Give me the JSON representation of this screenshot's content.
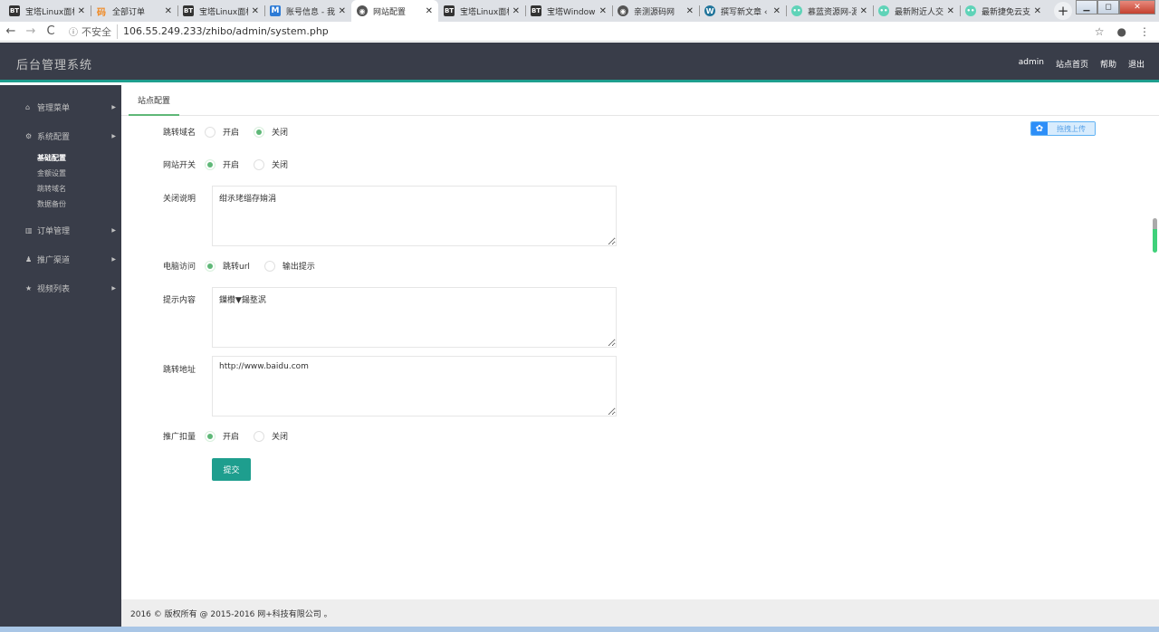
{
  "browser": {
    "tabs": [
      {
        "icon": "bt-icon",
        "glyph": "BT",
        "cls": "bt",
        "title": "宝塔Linux面板",
        "active": false
      },
      {
        "icon": "order-icon",
        "glyph": "码",
        "cls": "order",
        "title": "全部订单",
        "active": false
      },
      {
        "icon": "bt-icon",
        "glyph": "BT",
        "cls": "bt",
        "title": "宝塔Linux面板",
        "active": false
      },
      {
        "icon": "m-icon",
        "glyph": "M",
        "cls": "m",
        "title": "账号信息 - 我的",
        "active": false
      },
      {
        "icon": "globe-icon",
        "glyph": "◉",
        "cls": "globe",
        "title": "网站配置",
        "active": true
      },
      {
        "icon": "bt-icon",
        "glyph": "BT",
        "cls": "bt",
        "title": "宝塔Linux面板",
        "active": false
      },
      {
        "icon": "bt-icon",
        "glyph": "BT",
        "cls": "bt",
        "title": "宝塔Windows",
        "active": false
      },
      {
        "icon": "globe-icon",
        "glyph": "◉",
        "cls": "globe",
        "title": "亲测源码网",
        "active": false
      },
      {
        "icon": "wordpress-icon",
        "glyph": "W",
        "cls": "wp",
        "title": "撰写新文章 ‹",
        "active": false
      },
      {
        "icon": "face-icon",
        "glyph": "••",
        "cls": "face",
        "title": "慕蓝资源网-源",
        "active": false
      },
      {
        "icon": "face-icon",
        "glyph": "••",
        "cls": "face",
        "title": "最新附近人交友",
        "active": false
      },
      {
        "icon": "face-icon",
        "glyph": "••",
        "cls": "face",
        "title": "最新捷免云支付",
        "active": false
      }
    ],
    "close_glyph": "✕",
    "new_tab": "+",
    "back": "←",
    "forward": "→",
    "reload": "C",
    "info_glyph": "ⓘ",
    "security": "不安全",
    "url": "106.55.249.233/zhibo/admin/system.php",
    "star": "☆",
    "account": "●",
    "menu": "⋮",
    "win_min": "▁",
    "win_max": "◻",
    "win_close": "✕"
  },
  "header": {
    "title": "后台管理系统",
    "nav": [
      "admin",
      "站点首页",
      "帮助",
      "退出"
    ]
  },
  "sidebar": {
    "items": [
      {
        "icon": "home-icon",
        "glyph": "⌂",
        "label": "管理菜单"
      },
      {
        "icon": "gears-icon",
        "glyph": "⚙",
        "label": "系统配置"
      },
      {
        "icon": "bar-chart-icon",
        "glyph": "▥",
        "label": "订单管理"
      },
      {
        "icon": "user-icon",
        "glyph": "♟",
        "label": "推广渠道"
      },
      {
        "icon": "star-icon",
        "glyph": "★",
        "label": "视频列表"
      }
    ],
    "subitems": [
      "基础配置",
      "金额设置",
      "跳转域名",
      "数据备份"
    ],
    "arrow": "▶"
  },
  "main": {
    "tab": "站点配置",
    "upload": {
      "icon": "cloud-upload-icon",
      "glyph": "✿",
      "label": "拖拽上传"
    },
    "fields": {
      "redirect_domain": {
        "label": "跳转域名",
        "options": [
          "开启",
          "关闭"
        ],
        "selected": "关闭"
      },
      "site_switch": {
        "label": "网站开关",
        "options": [
          "开启",
          "关闭"
        ],
        "selected": "开启"
      },
      "close_note": {
        "label": "关闭说明",
        "value": "绀氶珯缁存姢涓"
      },
      "pc_access": {
        "label": "电脑访问",
        "options": [
          "跳转url",
          "输出提示"
        ],
        "selected": "跳转url"
      },
      "tip_content": {
        "label": "提示内容",
        "value": "鏁欑▼鍚堥泦"
      },
      "redirect_url": {
        "label": "跳转地址",
        "value": "http://www.baidu.com"
      },
      "promo_deduct": {
        "label": "推广扣量",
        "options": [
          "开启",
          "关闭"
        ],
        "selected": "开启"
      }
    },
    "submit": "提交"
  },
  "footer": {
    "text": "2016 © 版权所有 @ 2015-2016 网+科技有限公司 。"
  }
}
